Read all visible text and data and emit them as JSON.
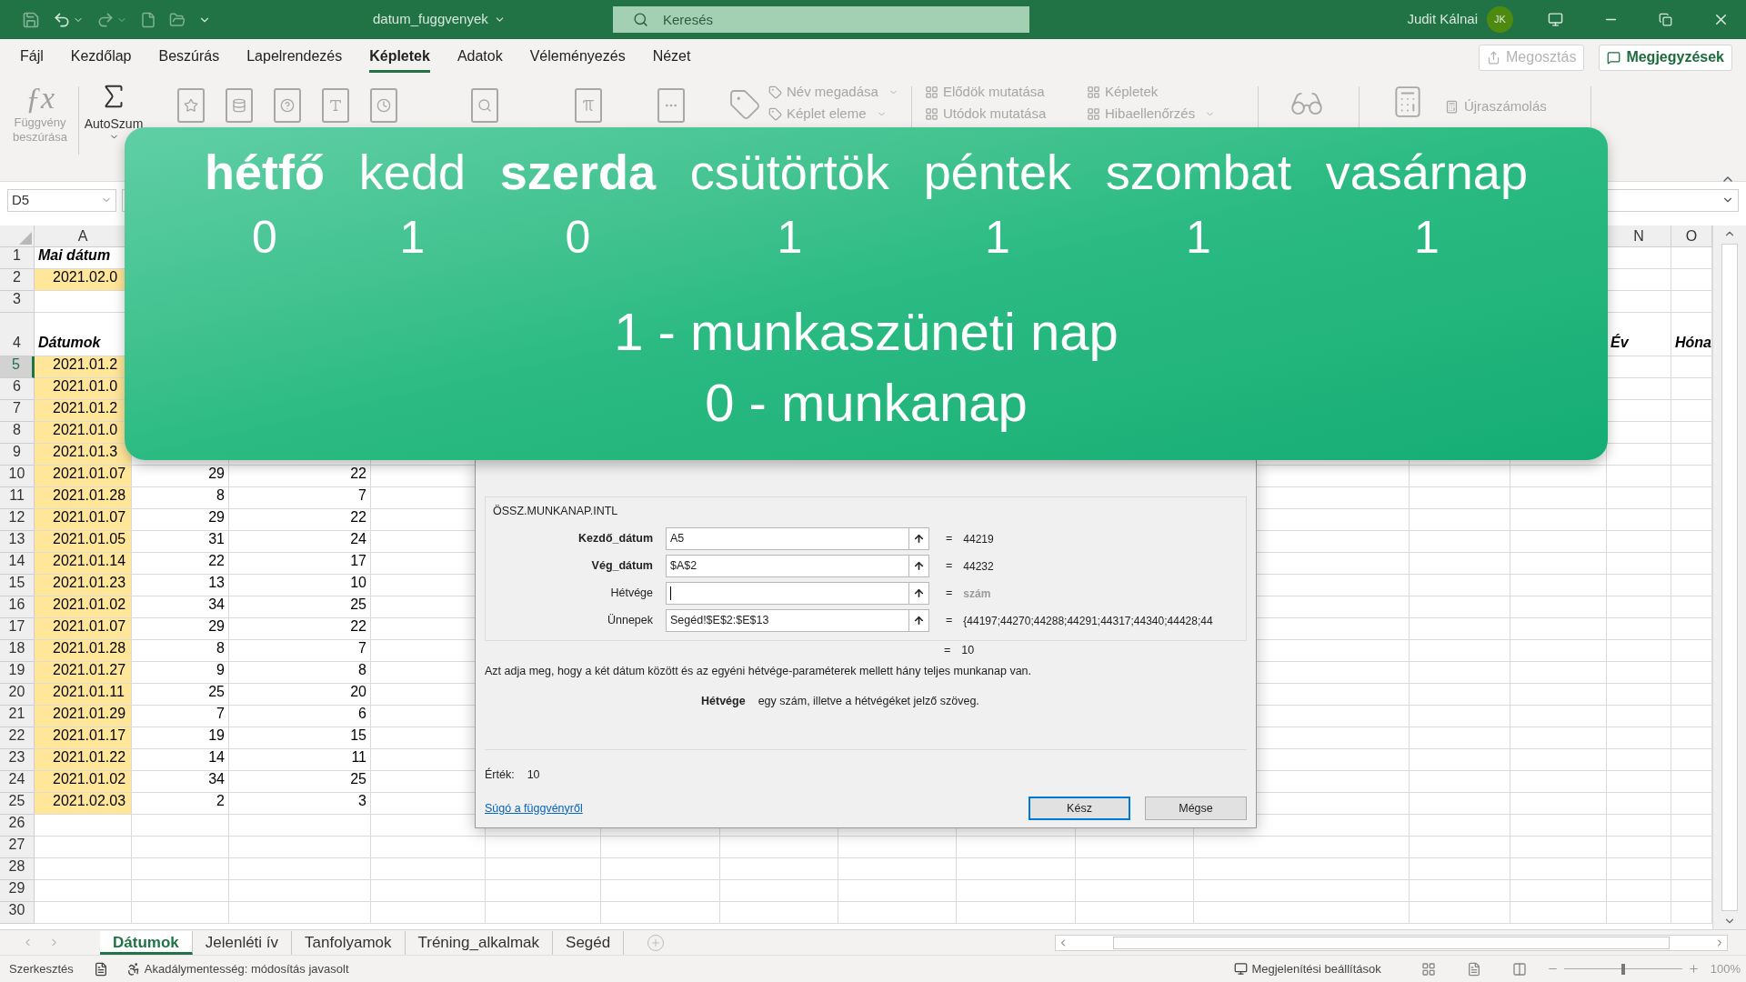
{
  "title_bar": {
    "title": "datum_fuggvenyek",
    "search": {
      "placeholder": "Keresés"
    },
    "user": "Judit Kálnai",
    "avatar": "JK"
  },
  "menu_tabs": [
    {
      "label": "Fájl",
      "selected": false
    },
    {
      "label": "Kezdőlap",
      "selected": false
    },
    {
      "label": "Beszúrás",
      "selected": false
    },
    {
      "label": "Lapelrendezés",
      "selected": false
    },
    {
      "label": "Képletek",
      "selected": true
    },
    {
      "label": "Adatok",
      "selected": false
    },
    {
      "label": "Véleményezés",
      "selected": false
    },
    {
      "label": "Nézet",
      "selected": false
    }
  ],
  "header_buttons": [
    {
      "label": "Megosztás",
      "disabled": true
    },
    {
      "label": "Megjegyzések",
      "disabled": false
    }
  ],
  "ribbon": {
    "insert_function_icon": "ƒx",
    "insert_function": "Függvény beszúrása",
    "autosum": "AutoSzum",
    "name_items": [
      {
        "label": "Név megadása",
        "dropdown": true
      },
      {
        "label": "Képlet eleme",
        "dropdown": true
      }
    ],
    "audit_items": [
      {
        "label": "Elődök mutatása",
        "dropdown": false
      },
      {
        "label": "Képletek",
        "dropdown": false
      },
      {
        "label": "Utódok mutatása",
        "dropdown": false
      },
      {
        "label": "Hibaellenőrzés",
        "dropdown": true
      }
    ],
    "calc_items": [
      {
        "label": "Újraszámolás"
      }
    ]
  },
  "name_box": "D5",
  "column_headers": {
    "A": "A",
    "N": "N",
    "O": "O"
  },
  "rows": [
    {
      "number": "1",
      "selected": false,
      "kind": "header",
      "A": "Mai dátum"
    },
    {
      "number": "2",
      "selected": false,
      "kind": "date",
      "A": "2021.02.0"
    },
    {
      "number": "3",
      "selected": false,
      "kind": "blank"
    },
    {
      "number": "4",
      "selected": false,
      "kind": "header",
      "A": "Dátumok",
      "N": "Év",
      "O": "Hóna"
    },
    {
      "number": "5",
      "selected": true,
      "kind": "date",
      "A": "2021.01.2"
    },
    {
      "number": "6",
      "selected": false,
      "kind": "date",
      "A": "2021.01.0"
    },
    {
      "number": "7",
      "selected": false,
      "kind": "date",
      "A": "2021.01.2"
    },
    {
      "number": "8",
      "selected": false,
      "kind": "date",
      "A": "2021.01.0"
    },
    {
      "number": "9",
      "selected": false,
      "kind": "date",
      "A": "2021.01.3"
    },
    {
      "number": "10",
      "selected": false,
      "kind": "date",
      "A": "2021.01.07",
      "B": "29",
      "C": "22"
    },
    {
      "number": "11",
      "selected": false,
      "kind": "date",
      "A": "2021.01.28",
      "B": "8",
      "C": "7"
    },
    {
      "number": "12",
      "selected": false,
      "kind": "date",
      "A": "2021.01.07",
      "B": "29",
      "C": "22"
    },
    {
      "number": "13",
      "selected": false,
      "kind": "date",
      "A": "2021.01.05",
      "B": "31",
      "C": "24"
    },
    {
      "number": "14",
      "selected": false,
      "kind": "date",
      "A": "2021.01.14",
      "B": "22",
      "C": "17"
    },
    {
      "number": "15",
      "selected": false,
      "kind": "date",
      "A": "2021.01.23",
      "B": "13",
      "C": "10"
    },
    {
      "number": "16",
      "selected": false,
      "kind": "date",
      "A": "2021.01.02",
      "B": "34",
      "C": "25"
    },
    {
      "number": "17",
      "selected": false,
      "kind": "date",
      "A": "2021.01.07",
      "B": "29",
      "C": "22"
    },
    {
      "number": "18",
      "selected": false,
      "kind": "date",
      "A": "2021.01.28",
      "B": "8",
      "C": "7"
    },
    {
      "number": "19",
      "selected": false,
      "kind": "date",
      "A": "2021.01.27",
      "B": "9",
      "C": "8"
    },
    {
      "number": "20",
      "selected": false,
      "kind": "date",
      "A": "2021.01.11",
      "B": "25",
      "C": "20"
    },
    {
      "number": "21",
      "selected": false,
      "kind": "date",
      "A": "2021.01.29",
      "B": "7",
      "C": "6"
    },
    {
      "number": "22",
      "selected": false,
      "kind": "date",
      "A": "2021.01.17",
      "B": "19",
      "C": "15"
    },
    {
      "number": "23",
      "selected": false,
      "kind": "date",
      "A": "2021.01.22",
      "B": "14",
      "C": "11"
    },
    {
      "number": "24",
      "selected": false,
      "kind": "date",
      "A": "2021.01.02",
      "B": "34",
      "C": "25"
    },
    {
      "number": "25",
      "selected": false,
      "kind": "date",
      "A": "2021.02.03",
      "B": "2",
      "C": "3"
    },
    {
      "number": "26",
      "selected": false,
      "kind": "blank"
    },
    {
      "number": "27",
      "selected": false,
      "kind": "blank"
    },
    {
      "number": "28",
      "selected": false,
      "kind": "blank"
    },
    {
      "number": "29",
      "selected": false,
      "kind": "blank"
    },
    {
      "number": "30",
      "selected": false,
      "kind": "blank"
    }
  ],
  "overlay": {
    "days": [
      {
        "name": "hétfő",
        "value": "0",
        "emphasized": true
      },
      {
        "name": "kedd",
        "value": "1",
        "emphasized": false
      },
      {
        "name": "szerda",
        "value": "0",
        "emphasized": true
      },
      {
        "name": "csütörtök",
        "value": "1",
        "emphasized": false
      },
      {
        "name": "péntek",
        "value": "1",
        "emphasized": false
      },
      {
        "name": "szombat",
        "value": "1",
        "emphasized": false
      },
      {
        "name": "vasárnap",
        "value": "1",
        "emphasized": false
      }
    ],
    "legend": [
      "1 - munkaszüneti nap",
      "0 - munkanap"
    ]
  },
  "dialog": {
    "function": "ÖSSZ.MUNKANAP.INTL",
    "arguments": [
      {
        "label": "Kezdő_dátum",
        "required": true,
        "value": "A5",
        "focused": false,
        "sign": "=",
        "result": "44219",
        "hint": false
      },
      {
        "label": "Vég_dátum",
        "required": true,
        "value": "$A$2",
        "focused": false,
        "sign": "=",
        "result": "44232",
        "hint": false
      },
      {
        "label": "Hétvége",
        "required": false,
        "focused": true,
        "sign": "=",
        "result": "szám",
        "hint": true
      },
      {
        "label": "Ünnepek",
        "required": false,
        "value": "Segéd!$E$2:$E$13",
        "focused": false,
        "sign": "=",
        "result": "{44197;44270;44288;44291;44317;44340;44428;44",
        "hint": false
      }
    ],
    "formula_sign": "=",
    "formula_result": "10",
    "description": "Azt adja meg, hogy a két dátum között és az egyéni hétvége-paraméterek mellett hány teljes munkanap van.",
    "param_name": "Hétvége",
    "param_description": "egy szám, illetve a hétvégéket jelző szöveg.",
    "value_label": "Érték:",
    "value": "10",
    "help_link": "Súgó a függvényről",
    "buttons": [
      {
        "label": "Kész",
        "default": true
      },
      {
        "label": "Mégse",
        "default": false
      }
    ]
  },
  "sheet_tabs": [
    {
      "label": "Dátumok",
      "selected": true
    },
    {
      "label": "Jelenléti ív",
      "selected": false
    },
    {
      "label": "Tanfolyamok",
      "selected": false
    },
    {
      "label": "Tréning_alkalmak",
      "selected": false
    },
    {
      "label": "Segéd",
      "selected": false
    }
  ],
  "status_bar": {
    "mode": "Szerkesztés",
    "accessibility": "Akadálymentesség: módosítás javasolt",
    "display_settings": "Megjelenítési beállítások",
    "zoom": "100%",
    "zoom_slider": {
      "level": 0.5
    }
  }
}
